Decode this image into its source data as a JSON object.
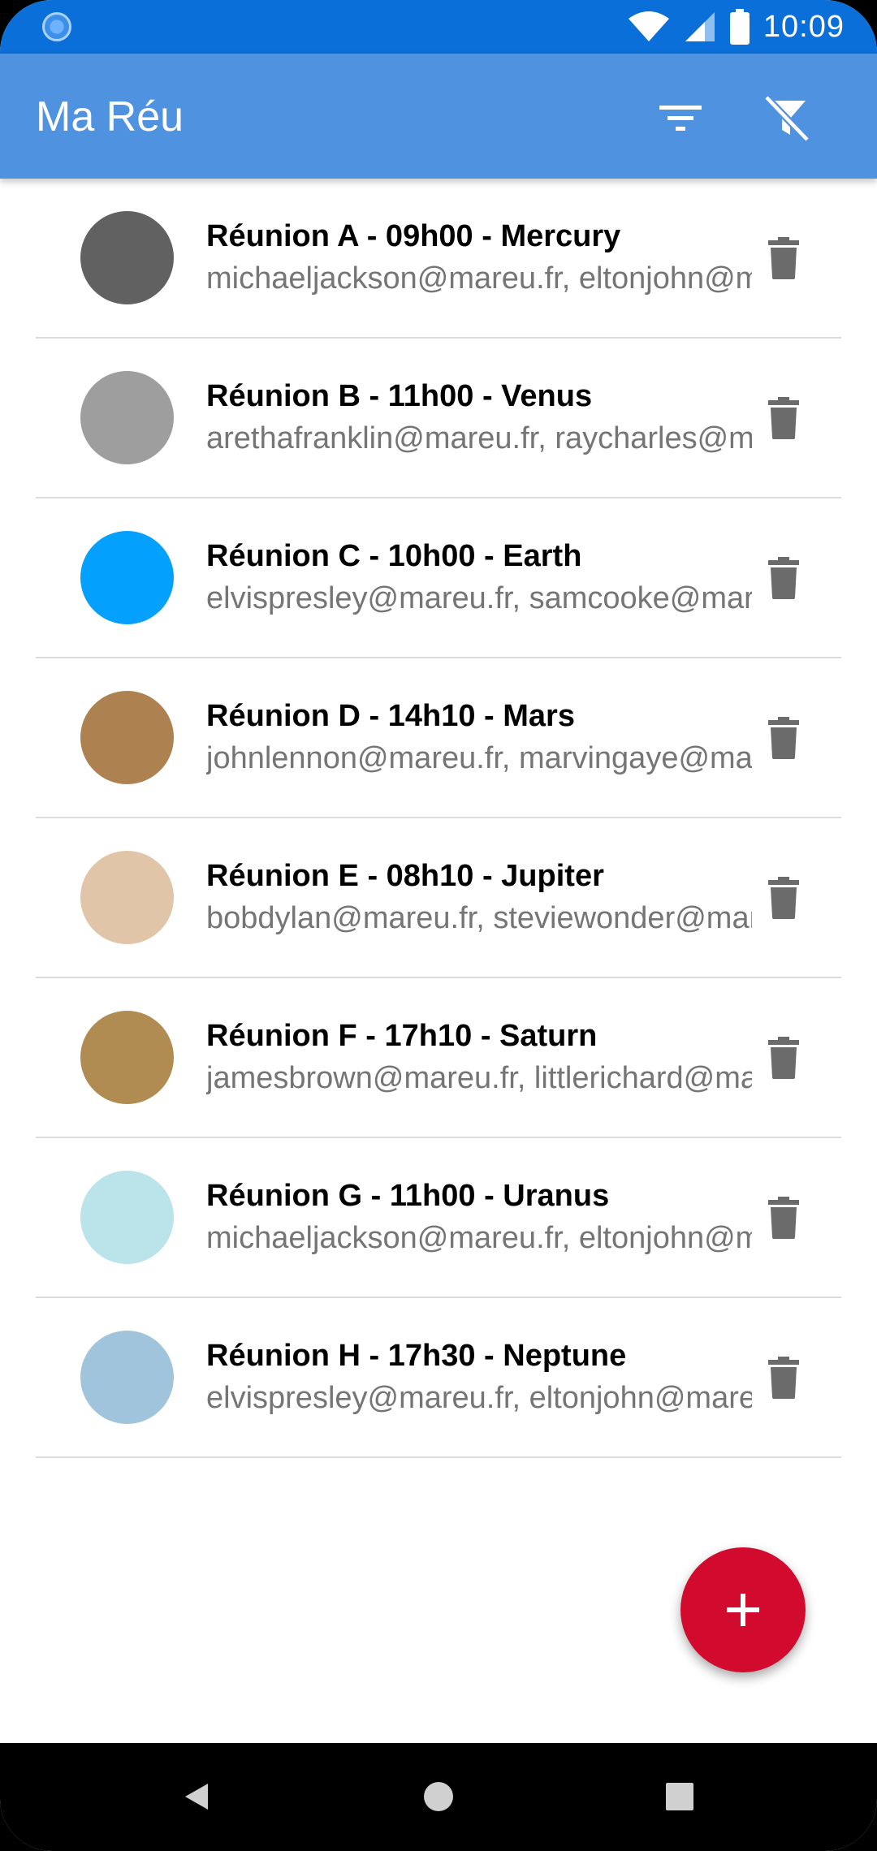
{
  "status_bar": {
    "time": "10:09",
    "icons": [
      "sync-icon",
      "wifi-icon",
      "signal-icon",
      "battery-icon"
    ]
  },
  "app_bar": {
    "title": "Ma Réu",
    "actions": [
      "filter-icon",
      "filter-off-icon"
    ]
  },
  "meetings": [
    {
      "title": "Réunion A - 09h00 - Mercury",
      "emails": "michaeljackson@mareu.fr, eltonjohn@mareu.fr",
      "color": "#616161"
    },
    {
      "title": "Réunion B - 11h00 - Venus",
      "emails": "arethafranklin@mareu.fr, raycharles@mareu.fr",
      "color": "#9e9e9e"
    },
    {
      "title": "Réunion C - 10h00 - Earth",
      "emails": "elvispresley@mareu.fr, samcooke@mareu.fr",
      "color": "#03a0fd"
    },
    {
      "title": "Réunion D - 14h10 - Mars",
      "emails": "johnlennon@mareu.fr, marvingaye@mareu.fr",
      "color": "#ad8150"
    },
    {
      "title": "Réunion E - 08h10 - Jupiter",
      "emails": "bobdylan@mareu.fr, steviewonder@mareu.fr",
      "color": "#e0c5a8"
    },
    {
      "title": "Réunion F - 17h10 - Saturn",
      "emails": "jamesbrown@mareu.fr, littlerichard@mareu.fr",
      "color": "#b08c53"
    },
    {
      "title": "Réunion G - 11h00 - Uranus",
      "emails": "michaeljackson@mareu.fr, eltonjohn@mareu.fr",
      "color": "#bae3ea"
    },
    {
      "title": "Réunion H - 17h30 - Neptune",
      "emails": "elvispresley@mareu.fr, eltonjohn@mareu.fr",
      "color": "#a1c4dd"
    }
  ],
  "fab": {
    "icon": "add-icon",
    "color": "#d10a2e"
  },
  "nav_bar": {
    "buttons": [
      "back-icon",
      "home-icon",
      "recents-icon"
    ]
  },
  "colors": {
    "status_bar": "#0a6fd8",
    "app_bar": "#4f92e0",
    "delete_icon": "#6b6b6b"
  }
}
